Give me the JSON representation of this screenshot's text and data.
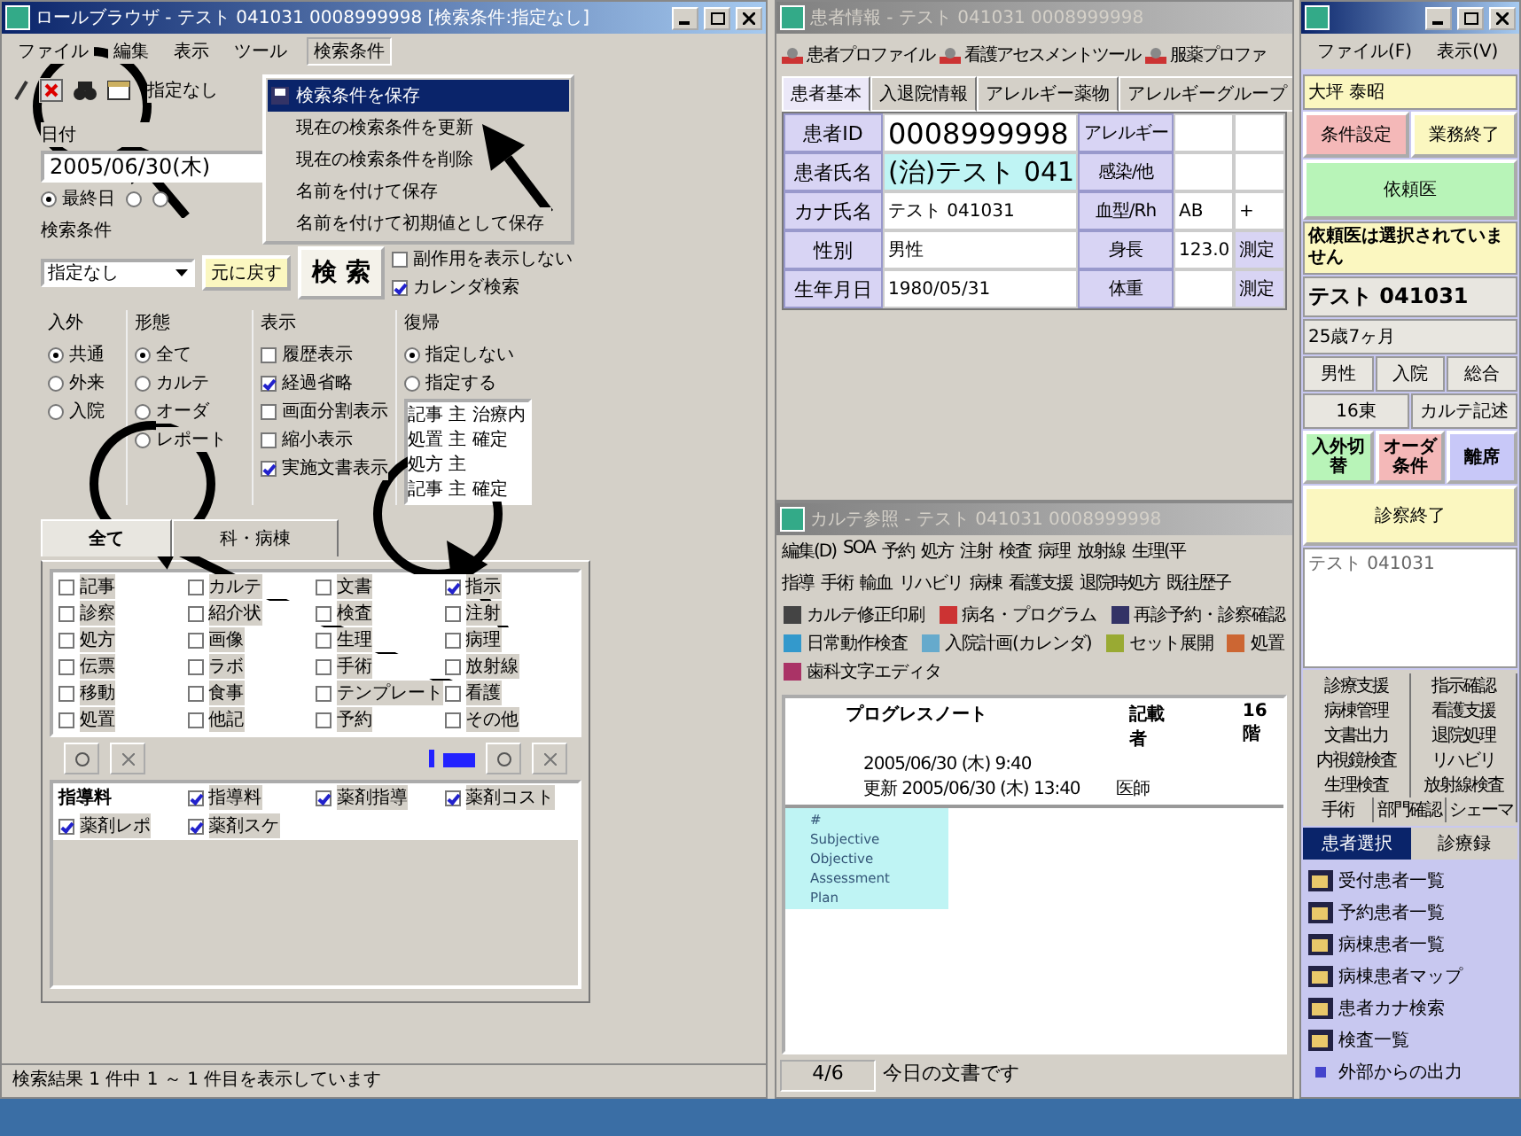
{
  "left_window": {
    "title": "ロールブラウザ - テスト 041031 0008999998 [検索条件:指定なし]",
    "menu": [
      {
        "label": "ファイル",
        "open": false
      },
      {
        "label": "編集",
        "open": false
      },
      {
        "label": "表示",
        "open": false
      },
      {
        "label": "ツール",
        "open": false
      },
      {
        "label": "検索条件",
        "open": true
      }
    ],
    "toolbar_label": "指定なし",
    "dropdown": [
      {
        "label": "検索条件を保存",
        "selected": true
      },
      {
        "label": "現在の検索条件を更新",
        "selected": false
      },
      {
        "label": "現在の検索条件を削除",
        "selected": false
      },
      {
        "label": "名前を付けて保存",
        "selected": false
      },
      {
        "label": "名前を付けて初期値として保存",
        "selected": false
      }
    ],
    "date": {
      "label": "日付",
      "value": "2005/06/30(木)"
    },
    "date_radios": [
      {
        "label": "最終日",
        "selected": true
      },
      {
        "selected": false
      },
      {
        "selected": false
      }
    ],
    "condition": {
      "label": "検索条件",
      "value": "指定なし"
    },
    "reset_button": "元に戻す",
    "search_button": "検 索",
    "options": [
      {
        "label": "副作用を表示しない",
        "checked": false
      },
      {
        "label": "カレンダ検索",
        "checked": true
      }
    ],
    "groups": [
      {
        "title": "入外",
        "kind": "radio",
        "items": [
          {
            "label": "共通",
            "selected": true
          },
          {
            "label": "外来",
            "selected": false
          },
          {
            "label": "入院",
            "selected": false
          }
        ]
      },
      {
        "title": "形態",
        "kind": "radio",
        "items": [
          {
            "label": "全て",
            "selected": true
          },
          {
            "label": "カルテ",
            "selected": false
          },
          {
            "label": "オーダ",
            "selected": false
          },
          {
            "label": "レポート",
            "selected": false
          }
        ]
      },
      {
        "title": "表示",
        "kind": "check",
        "items": [
          {
            "label": "履歴表示",
            "selected": false
          },
          {
            "label": "経過省略",
            "selected": true
          },
          {
            "label": "画面分割表示",
            "selected": false
          },
          {
            "label": "縮小表示",
            "selected": false
          },
          {
            "label": "実施文書表示",
            "selected": true
          }
        ]
      },
      {
        "title": "復帰",
        "kind": "radio",
        "items": [
          {
            "label": "指定しない",
            "selected": true
          },
          {
            "label": "指定する",
            "selected": false
          }
        ],
        "list": [
          "記事 主 治療内",
          "処置 主 確定",
          "処方 主",
          "記事 主 確定"
        ]
      }
    ],
    "tabs": [
      {
        "label": "全て",
        "selected": true
      },
      {
        "label": "科・病棟",
        "selected": false
      }
    ],
    "categories": [
      {
        "label": "記事",
        "checked": false
      },
      {
        "label": "カルテ",
        "checked": false
      },
      {
        "label": "文書",
        "checked": false
      },
      {
        "label": "指示",
        "checked": true
      },
      {
        "label": "診察",
        "checked": false
      },
      {
        "label": "紹介状",
        "checked": false
      },
      {
        "label": "検査",
        "checked": false
      },
      {
        "label": "注射",
        "checked": false
      },
      {
        "label": "処方",
        "checked": false
      },
      {
        "label": "画像",
        "checked": false
      },
      {
        "label": "生理",
        "checked": false
      },
      {
        "label": "病理",
        "checked": false
      },
      {
        "label": "伝票",
        "checked": false
      },
      {
        "label": "ラボ",
        "checked": false
      },
      {
        "label": "手術",
        "checked": false
      },
      {
        "label": "放射線",
        "checked": false
      },
      {
        "label": "移動",
        "checked": false
      },
      {
        "label": "食事",
        "checked": false
      },
      {
        "label": "テンプレート",
        "checked": false
      },
      {
        "label": "看護",
        "checked": false
      },
      {
        "label": "処置",
        "checked": false
      },
      {
        "label": "他記",
        "checked": false
      },
      {
        "label": "予約",
        "checked": false
      },
      {
        "label": "その他",
        "checked": false
      }
    ],
    "selected_heading": "指導料",
    "selected_items": [
      {
        "label": "指導料",
        "checked": true
      },
      {
        "label": "薬剤指導",
        "checked": true
      },
      {
        "label": "薬剤コスト",
        "checked": true
      },
      {
        "label": "薬剤レポ",
        "checked": true
      },
      {
        "label": "薬剤スケ",
        "checked": true
      }
    ],
    "status": "検索結果 1 件中 1 ～ 1 件目を表示しています"
  },
  "patient_window": {
    "title": "患者情報 - テスト 041031 0008999998",
    "toolbar": [
      "患者プロファイル",
      "看護アセスメントツール",
      "服薬プロファ"
    ],
    "tabs": [
      {
        "label": "患者基本",
        "selected": true
      },
      {
        "label": "入退院情報",
        "selected": false
      },
      {
        "label": "アレルギー薬物",
        "selected": false
      },
      {
        "label": "アレルギーグループ",
        "selected": false
      }
    ],
    "rows": [
      {
        "label": "患者ID",
        "value": "0008999998",
        "kind": "large",
        "label2": "アレルギー",
        "value2": "",
        "value3": ""
      },
      {
        "label": "患者氏名",
        "value": "(治)テスト 041",
        "kind": "name",
        "label2": "感染/他",
        "value2": "",
        "value3": ""
      },
      {
        "label": "カナ氏名",
        "value": "テスト 041031",
        "kind": "small",
        "label2": "血型/Rh",
        "value2": "AB",
        "value3": "+"
      },
      {
        "label": "性別",
        "value": "男性",
        "kind": "small",
        "label2": "身長",
        "value2": "123.0",
        "value3": "測定"
      },
      {
        "label": "生年月日",
        "value": "1980/05/31",
        "kind": "small",
        "label2": "体重",
        "value2": "",
        "value3": "測定"
      }
    ]
  },
  "chart_window": {
    "title": "カルテ参照 - テスト 041031 0008999998",
    "menu_rows": [
      [
        "編集(D)",
        "SOA",
        "予約",
        "処方",
        "注射",
        "検査",
        "病理",
        "放射線",
        "生理(平"
      ],
      [
        "指導",
        "手術",
        "輸血",
        "リハビリ",
        "病棟",
        "看護支援",
        "退院時処方",
        "既往歴子"
      ]
    ],
    "tools": [
      "カルテ修正印刷",
      "病名・プログラム",
      "再診予約・診察確認",
      "日常動作検査",
      "入院計画(カレンダ)",
      "セット展開",
      "処置",
      "歯科文字エディタ"
    ],
    "doc": {
      "type": "プログレスノート",
      "author_label": "記載者",
      "ward": "16階",
      "created": "2005/06/30 (木) 9:40",
      "updated": "更新 2005/06/30 (木) 13:40",
      "role": "医師"
    },
    "soap": [
      "#",
      "Subjective",
      "Objective",
      "Assessment",
      "Plan"
    ],
    "page": "4/6",
    "status": "今日の文書です"
  },
  "side_window": {
    "menu": [
      "ファイル(F)",
      "表示(V)"
    ],
    "user": "大坪 泰昭",
    "buttons_top": [
      {
        "label": "条件設定",
        "color": "#f4b8b8"
      },
      {
        "label": "業務終了",
        "color": "#fbf7c0"
      }
    ],
    "doctor_button": {
      "label": "依頼医",
      "color": "#b8f4b8"
    },
    "doctor_note": "依頼医は選択されていません",
    "patient": "テスト 041031",
    "age": "25歳7ヶ月",
    "info": [
      [
        "男性",
        "入院",
        "総合"
      ],
      [
        "16東",
        "カルテ記述"
      ]
    ],
    "buttons_mid": [
      {
        "label": "入外切替",
        "color": "#b8f4b8"
      },
      {
        "label": "オーダ条件",
        "color": "#f4b8b8"
      },
      {
        "label": "離席",
        "color": "#c8c8f8"
      }
    ],
    "finish_button": {
      "label": "診察終了",
      "color": "#fbf7c0"
    },
    "patient_list": [
      "テスト 041031"
    ],
    "functions": [
      [
        "診療支援",
        "指示確認"
      ],
      [
        "病棟管理",
        "看護支援"
      ],
      [
        "文書出力",
        "退院処理"
      ],
      [
        "内視鏡検査",
        "リハビリ"
      ],
      [
        "生理検査",
        "放射線検査"
      ],
      [
        "手術",
        "部門確認",
        "シェーマ"
      ]
    ],
    "tabs": [
      {
        "label": "患者選択",
        "selected": true
      },
      {
        "label": "診療録",
        "selected": false
      }
    ],
    "lists": [
      {
        "label": "受付患者一覧",
        "kind": "icon"
      },
      {
        "label": "予約患者一覧",
        "kind": "icon"
      },
      {
        "label": "病棟患者一覧",
        "kind": "icon"
      },
      {
        "label": "病棟患者マップ",
        "kind": "icon"
      },
      {
        "label": "患者カナ検索",
        "kind": "icon"
      },
      {
        "label": "検査一覧",
        "kind": "icon"
      },
      {
        "label": "外部からの出力",
        "kind": "bullet"
      }
    ]
  }
}
